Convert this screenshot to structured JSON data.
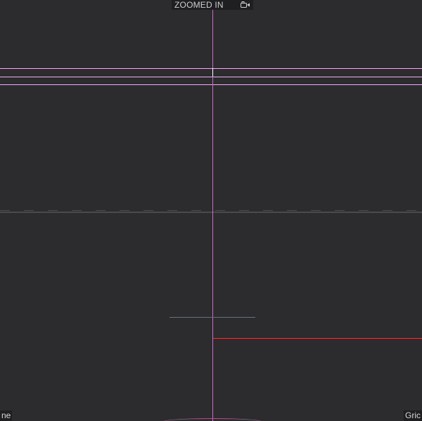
{
  "viewport": {
    "mode_label": "ZOOMED IN",
    "camera_icon": "camera-icon"
  },
  "corners": {
    "left_label": "ne",
    "right_label": "Gric"
  },
  "colors": {
    "background": "#2c2b2e",
    "guide_vertical": "#b77ab5",
    "guide_horizontal": "#e4b6e6",
    "blue_segment": "#3f79c9",
    "red_segment": "#c9424a"
  }
}
